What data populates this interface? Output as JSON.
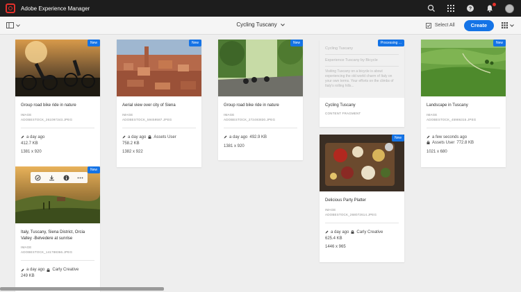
{
  "shell": {
    "title": "Adobe Experience Manager"
  },
  "actionbar": {
    "breadcrumb": "Cycling Tuscany",
    "select_all": "Select All",
    "create": "Create"
  },
  "colors": {
    "accent": "#1473e6",
    "brand_red": "#e4312b",
    "shell_bg": "#1d1d1d"
  },
  "cards": [
    {
      "badge": "New",
      "title": "Group road bike ride in nature",
      "type": "IMAGE",
      "file": "ADOBESTOCK_261097343.JPEG",
      "modified": "a day ago",
      "owner": "",
      "size": "412.7 KB",
      "dims": "1381 x 920"
    },
    {
      "badge": "New",
      "title": "Aerial view over city of Siena",
      "type": "IMAGE",
      "file": "ADOBESTOCK_59459587.JPEG",
      "modified": "a day ago",
      "owner": "Assets User",
      "size": "758.2 KB",
      "dims": "1382 x 922"
    },
    {
      "badge": "New",
      "title": "Group road bike ride in nature",
      "type": "IMAGE",
      "file": "ADOBESTOCK_272493830.JPEG",
      "modified": "a day ago",
      "owner": "",
      "size": "492.9 KB",
      "dims": "1381 x 920"
    },
    {
      "badge": "Processing ...",
      "fragment_lines": [
        "Cycling Tuscany",
        "Experience Tuscany by Bicycle",
        "Visiting Tuscany on a bicycle is about experiencing the old world charm of Italy on your own terms. Your efforts on the climbs of Italy's rolling hills..."
      ],
      "title": "Cycling Tuscany",
      "type": "CONTENT FRAGMENT"
    },
    {
      "badge": "New",
      "title": "Landscape in Tuscany",
      "type": "IMAGE",
      "file": "ADOBESTOCK_45986315.JPEG",
      "modified": "a few seconds ago",
      "owner": "Assets User",
      "size": "772.8 KB",
      "dims": "1021 x 680"
    },
    {
      "badge": "New",
      "title": "Italy, Tuscany, Siena District, Orcia Valley -Belvedere at sunrise",
      "type": "IMAGE",
      "file": "ADOBESTOCK_141788366.JPEG",
      "modified": "a day ago",
      "owner": "Carly Creative",
      "size": "249 KB",
      "dims": ""
    },
    {
      "badge": "New",
      "title": "Delicious Party Platter",
      "type": "IMAGE",
      "file": "ADOBESTOCK_268072614.JPEG",
      "modified": "a day ago",
      "owner": "Carly Creative",
      "size": "625.4 KB",
      "dims": "1446 x 965"
    }
  ],
  "icons": [
    "adobe-logo-icon",
    "search-icon",
    "apps-grid-icon",
    "help-icon",
    "bell-icon",
    "rail-toggle-icon",
    "chevron-down-icon",
    "checkbox-icon",
    "grid-view-icon",
    "edit-icon",
    "lock-icon",
    "open-icon",
    "download-icon",
    "info-icon",
    "more-icon"
  ]
}
